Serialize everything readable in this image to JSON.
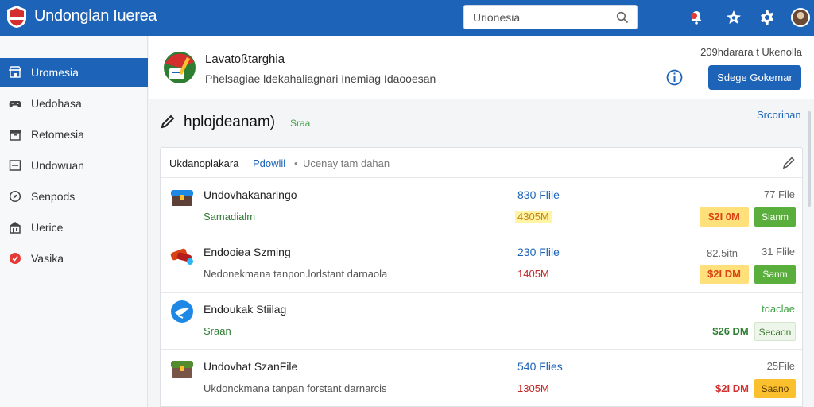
{
  "app": {
    "title": "Undonglan Iuerea"
  },
  "search": {
    "value": "Urionesia"
  },
  "sidebar": {
    "items": [
      {
        "label": "Uromesia",
        "icon": "storefront-icon",
        "active": true
      },
      {
        "label": "Uedohasa",
        "icon": "gamepad-icon",
        "active": false
      },
      {
        "label": "Retomesia",
        "icon": "archive-icon",
        "active": false
      },
      {
        "label": "Undowuan",
        "icon": "window-icon",
        "active": false
      },
      {
        "label": "Senpods",
        "icon": "compass-icon",
        "active": false
      },
      {
        "label": "Uerice",
        "icon": "building-icon",
        "active": false
      },
      {
        "label": "Vasika",
        "icon": "red-badge-icon",
        "active": false
      }
    ]
  },
  "header": {
    "title": "Lavatoßtarghia",
    "subtitle": "Phelsagiae ldekahaliagnari Inemiag Idaooesan",
    "meta": "209hdarara t Ukenolla",
    "button_label": "Sdege Gokemar"
  },
  "section": {
    "title": "hplojdeanam)",
    "badge": "Sraa",
    "link": "Srcorinan"
  },
  "breadcrumb": {
    "root": "Ukdanoplakara",
    "current": "Pdowlil",
    "separator": "•",
    "hint": "Ucenay tam dahan"
  },
  "rows": [
    {
      "name": "Undovhakanaringo",
      "subtitle": "Samadialm",
      "files": "830 Flile",
      "size": "4305M",
      "mid": "",
      "count": "77 File",
      "price": "$2I 0M",
      "tag": "Sianm"
    },
    {
      "name": "Endooiea Szming",
      "subtitle": "Nedonekmana tanpon.lorlstant darnaola",
      "files": "230 Flile",
      "size": "1405M",
      "mid": "82.5itn",
      "count": "31 Flile",
      "price": "$2I DM",
      "tag": "Sanm"
    },
    {
      "name": "Endoukak Stiilag",
      "subtitle": "Sraan",
      "files": "",
      "size": "",
      "mid": "",
      "count": "tdaclae",
      "price": "$26 DM",
      "tag": "Secaon"
    },
    {
      "name": "Undovhat SzanFile",
      "subtitle": "Ukdonckmana tanpan forstant darnarcis",
      "files": "540 Flies",
      "size": "1305M",
      "mid": "",
      "count": "25File",
      "price": "$2I DM",
      "tag": "Saano"
    }
  ],
  "colors": {
    "brand": "#1d63b8",
    "accent_green": "#5aaf3c",
    "accent_yellow": "#ffe07a",
    "accent_red": "#d32f2f"
  }
}
